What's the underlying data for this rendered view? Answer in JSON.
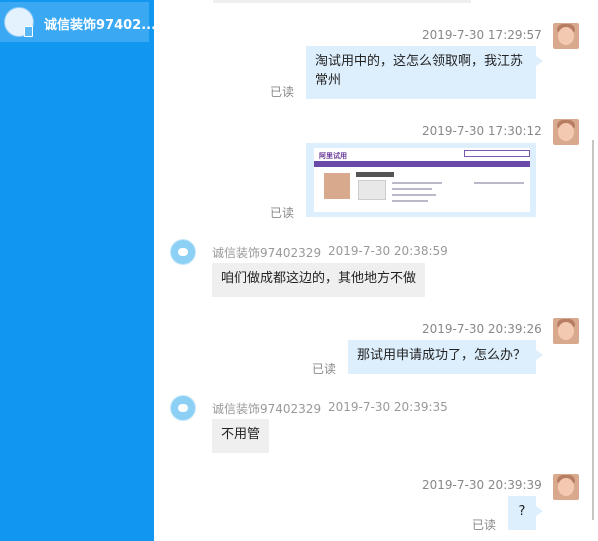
{
  "sidebar": {
    "contact": {
      "name": "诚信装饰97402..."
    }
  },
  "top_bubble_fragment": true,
  "messages": [
    {
      "side": "right",
      "timestamp": "2019-7-30 17:29:57",
      "text": "淘试用中的，这怎么领取啊，我江苏常州",
      "read": "已读"
    },
    {
      "side": "right",
      "timestamp": "2019-7-30 17:30:12",
      "type": "image",
      "image": {
        "brand": "阿里试用"
      },
      "read": "已读"
    },
    {
      "side": "left",
      "sender": "诚信装饰97402329",
      "timestamp": "2019-7-30 20:38:59",
      "text": "咱们做成都这边的，其他地方不做"
    },
    {
      "side": "right",
      "timestamp": "2019-7-30 20:39:26",
      "text": "那试用申请成功了，怎么办？",
      "read": "已读"
    },
    {
      "side": "left",
      "sender": "诚信装饰97402329",
      "timestamp": "2019-7-30 20:39:35",
      "text": "不用管"
    },
    {
      "side": "right",
      "timestamp": "2019-7-30 20:39:39",
      "text": "?",
      "read": "已读"
    }
  ]
}
